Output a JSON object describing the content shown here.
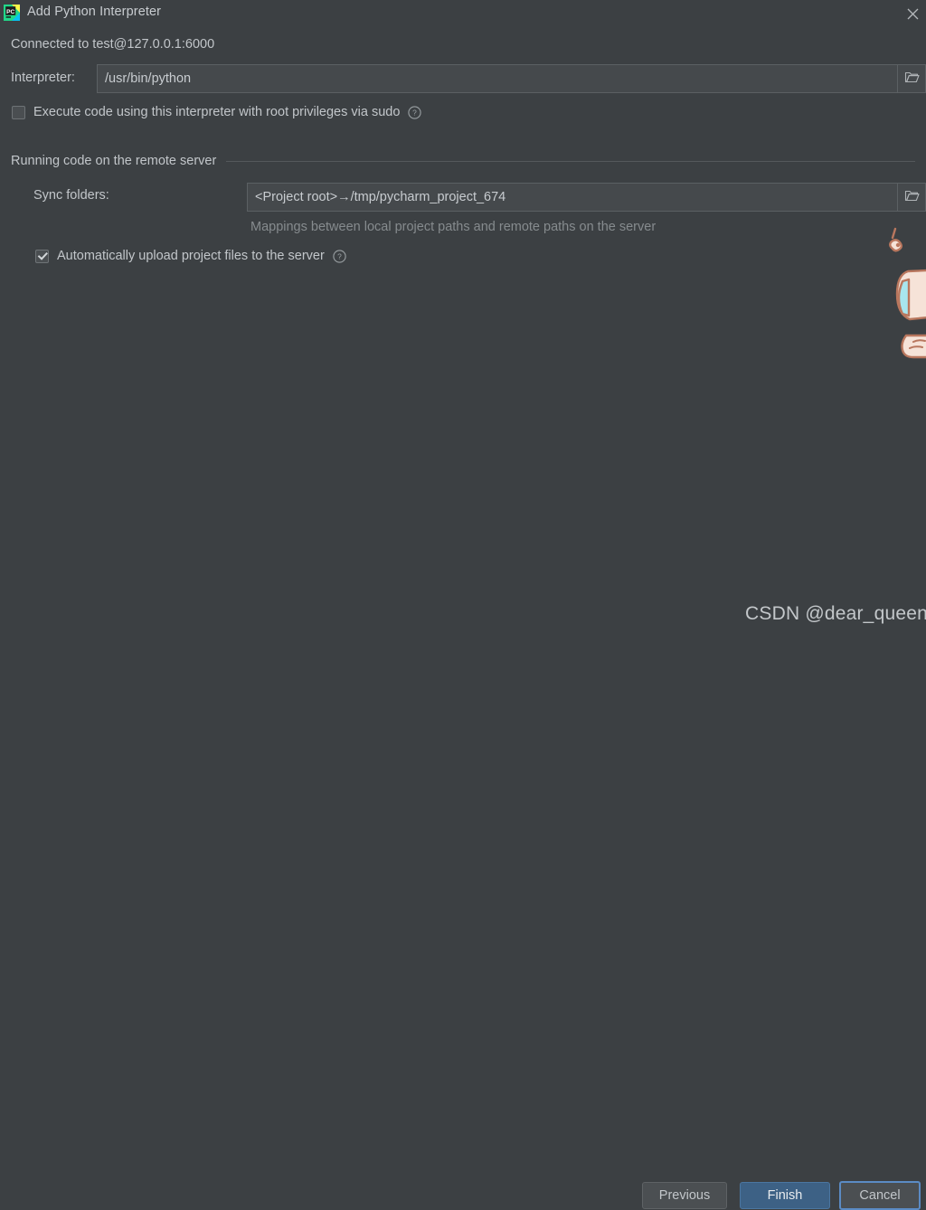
{
  "window": {
    "title": "Add Python Interpreter",
    "app_icon": "pycharm-logo-icon",
    "close_icon": "close-icon"
  },
  "colors": {
    "background": "#3c4043",
    "field_background": "#45494c",
    "field_border": "#5b6063",
    "text": "#c2c6ca",
    "hint_text": "#868b8e",
    "primary_button": "#3d6185",
    "focus_border": "#5b8bc4"
  },
  "status": {
    "connected_text": "Connected to test@127.0.0.1:6000"
  },
  "interpreter": {
    "label": "Interpreter:",
    "value": "/usr/bin/python",
    "browse_icon": "folder-icon"
  },
  "sudo": {
    "label": "Execute code using this interpreter with root privileges via sudo",
    "checked": false,
    "help_icon": "help-circle-icon"
  },
  "remote_group": {
    "title": "Running code on the remote server"
  },
  "sync": {
    "label": "Sync folders:",
    "value": "<Project root>→/tmp/pycharm_project_674",
    "browse_icon": "folder-icon",
    "hint": "Mappings between local project paths and remote paths on the server"
  },
  "auto_upload": {
    "label": "Automatically upload project files to the server",
    "checked": true,
    "help_icon": "help-circle-icon"
  },
  "footer": {
    "previous_label": "Previous",
    "finish_label": "Finish",
    "cancel_label": "Cancel"
  },
  "watermark": {
    "text": "CSDN @dear_queen"
  },
  "decoration": {
    "mascot": "cartoon-character-illustration"
  }
}
